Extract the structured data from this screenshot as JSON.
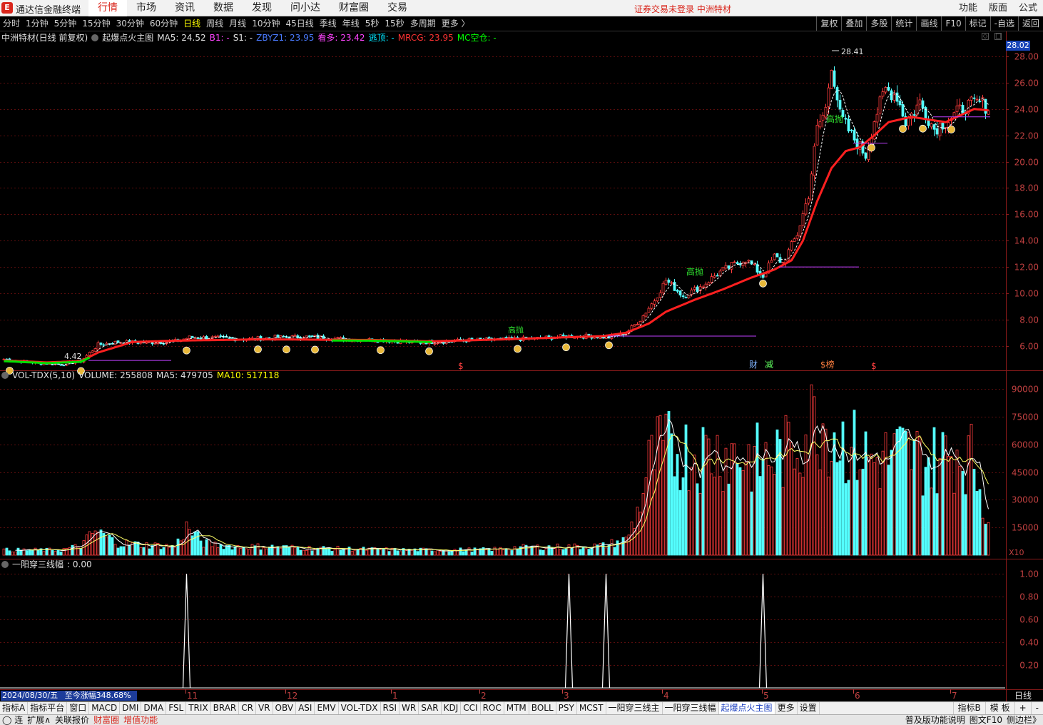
{
  "app": {
    "title": "通达信金融终端",
    "logo_char": "E"
  },
  "menu": {
    "items": [
      "行情",
      "市场",
      "资讯",
      "数据",
      "发现",
      "问小达",
      "财富圈",
      "交易"
    ],
    "active": "行情"
  },
  "login_status": "证券交易未登录  中洲特材",
  "right_menu": [
    "功能",
    "版面",
    "公式"
  ],
  "periods": {
    "items": [
      "分时",
      "1分钟",
      "5分钟",
      "15分钟",
      "30分钟",
      "60分钟",
      "日线",
      "周线",
      "月线",
      "10分钟",
      "45日线",
      "季线",
      "年线",
      "5秒",
      "15秒",
      "多周期",
      "更多 〉"
    ],
    "active": "日线"
  },
  "toolbar": [
    "复权",
    "叠加",
    "多股",
    "统计",
    "画线",
    "F10",
    "标记",
    "-自选",
    "返回"
  ],
  "main_header": {
    "stock": "中洲特材(日线 前复权)",
    "indicator": "起爆点火主图",
    "ma5": "MA5: 24.52",
    "b1": "B1: -",
    "s1": "S1: -",
    "zbyz": "ZBYZ1: 23.95",
    "kanduo": "看多: 23.42",
    "taoding": "逃顶: -",
    "mrcg": "MRCG: 23.95",
    "mc": "MC空仓: -"
  },
  "price_badge": "28.02",
  "vol_header": {
    "name": "VOL-TDX(5,10)",
    "volume": "VOLUME: 255808",
    "ma5": "MA5: 479705",
    "ma10": "MA10: 517118"
  },
  "ind_header": {
    "name": "一阳穿三线幅",
    "value": ": 0.00"
  },
  "annotations": {
    "high_price": "28.41",
    "low_price": "4.42",
    "gaopao": "高抛",
    "markers": [
      "财",
      "减",
      "$榜",
      "$",
      "$"
    ]
  },
  "chart_data": {
    "type": "candlestick",
    "price_axis": {
      "ticks": [
        6,
        8,
        10,
        12,
        14,
        16,
        18,
        20,
        22,
        24,
        26,
        28
      ],
      "range": [
        4.2,
        28.7
      ],
      "grid": true
    },
    "volume_axis": {
      "ticks": [
        15000,
        30000,
        45000,
        60000,
        75000,
        90000
      ],
      "range": [
        0,
        92000
      ],
      "unit": "X10"
    },
    "indicator_axis": {
      "ticks": [
        0.2,
        0.4,
        0.6,
        0.8,
        1.0
      ],
      "range": [
        0,
        1.05
      ]
    },
    "x_labels": [
      {
        "label": "11",
        "index": 64
      },
      {
        "label": "12",
        "index": 99
      },
      {
        "label": "1",
        "index": 136
      },
      {
        "label": "2",
        "index": 167
      },
      {
        "label": "3",
        "index": 196
      },
      {
        "label": "4",
        "index": 231
      },
      {
        "label": "5",
        "index": 266
      },
      {
        "label": "6",
        "index": 298
      },
      {
        "label": "7",
        "index": 332
      }
    ],
    "price_anchors": [
      [
        0,
        5.0
      ],
      [
        12,
        4.7
      ],
      [
        20,
        4.6
      ],
      [
        27,
        4.85
      ],
      [
        33,
        6.1
      ],
      [
        40,
        6.3
      ],
      [
        50,
        6.25
      ],
      [
        60,
        6.35
      ],
      [
        65,
        6.65
      ],
      [
        75,
        6.6
      ],
      [
        85,
        6.5
      ],
      [
        95,
        6.65
      ],
      [
        108,
        6.7
      ],
      [
        120,
        6.5
      ],
      [
        132,
        6.45
      ],
      [
        145,
        6.25
      ],
      [
        155,
        6.35
      ],
      [
        165,
        6.45
      ],
      [
        175,
        6.5
      ],
      [
        185,
        6.55
      ],
      [
        195,
        6.7
      ],
      [
        205,
        6.75
      ],
      [
        212,
        6.65
      ],
      [
        218,
        7.0
      ],
      [
        223,
        8.0
      ],
      [
        228,
        9.5
      ],
      [
        232,
        11.0
      ],
      [
        238,
        9.8
      ],
      [
        245,
        10.6
      ],
      [
        250,
        11.5
      ],
      [
        256,
        12.2
      ],
      [
        260,
        12.6
      ],
      [
        266,
        11.3
      ],
      [
        270,
        12.8
      ],
      [
        273,
        12.3
      ],
      [
        278,
        14.5
      ],
      [
        282,
        17.5
      ],
      [
        285,
        22.5
      ],
      [
        288,
        24.0
      ],
      [
        290,
        27.5
      ],
      [
        293,
        23.5
      ],
      [
        297,
        22.0
      ],
      [
        302,
        20.5
      ],
      [
        305,
        23.2
      ],
      [
        309,
        25.5
      ],
      [
        313,
        25.0
      ],
      [
        316,
        23.0
      ],
      [
        321,
        24.5
      ],
      [
        326,
        22.5
      ],
      [
        331,
        23.2
      ],
      [
        337,
        24.2
      ],
      [
        342,
        24.5
      ],
      [
        345,
        24.1
      ]
    ],
    "mrcg_anchors": [
      [
        0,
        4.9
      ],
      [
        15,
        4.75
      ],
      [
        27,
        4.85
      ],
      [
        33,
        5.5
      ],
      [
        45,
        6.3
      ],
      [
        60,
        6.4
      ],
      [
        90,
        6.5
      ],
      [
        130,
        6.45
      ],
      [
        150,
        6.35
      ],
      [
        175,
        6.5
      ],
      [
        210,
        6.75
      ],
      [
        218,
        7.0
      ],
      [
        226,
        7.7
      ],
      [
        232,
        8.6
      ],
      [
        242,
        9.5
      ],
      [
        252,
        10.3
      ],
      [
        262,
        11.2
      ],
      [
        270,
        11.8
      ],
      [
        276,
        12.5
      ],
      [
        280,
        14.0
      ],
      [
        285,
        17.0
      ],
      [
        290,
        19.5
      ],
      [
        295,
        20.8
      ],
      [
        300,
        21.1
      ],
      [
        305,
        22.0
      ],
      [
        310,
        23.0
      ],
      [
        318,
        23.4
      ],
      [
        330,
        23.0
      ],
      [
        340,
        24.0
      ],
      [
        345,
        23.9
      ]
    ],
    "volume_anchors": [
      [
        0,
        3000
      ],
      [
        20,
        3000
      ],
      [
        27,
        5500
      ],
      [
        32,
        14000
      ],
      [
        40,
        7000
      ],
      [
        60,
        5000
      ],
      [
        64,
        16000
      ],
      [
        70,
        7000
      ],
      [
        80,
        5000
      ],
      [
        90,
        5000
      ],
      [
        110,
        4000
      ],
      [
        140,
        3000
      ],
      [
        170,
        3200
      ],
      [
        180,
        4500
      ],
      [
        200,
        5000
      ],
      [
        210,
        5500
      ],
      [
        218,
        9000
      ],
      [
        222,
        25000
      ],
      [
        226,
        52000
      ],
      [
        230,
        62000
      ],
      [
        240,
        60000
      ],
      [
        255,
        60000
      ],
      [
        265,
        55000
      ],
      [
        275,
        60000
      ],
      [
        285,
        82000
      ],
      [
        295,
        65000
      ],
      [
        305,
        55000
      ],
      [
        315,
        60000
      ],
      [
        325,
        55000
      ],
      [
        335,
        62000
      ],
      [
        340,
        55000
      ],
      [
        344,
        25000
      ]
    ],
    "indicator_spikes": [
      64,
      198,
      211,
      266
    ],
    "bar_count": 346,
    "series": [
      {
        "name": "MRCG",
        "color": "#ff2020"
      },
      {
        "name": "MA5",
        "color": "#ffffff"
      },
      {
        "name": "VOL MA5",
        "color": "#ffffff"
      },
      {
        "name": "VOL MA10",
        "color": "#ffff66"
      }
    ]
  },
  "date_info": {
    "date": "2024/08/30/五",
    "change": "至今涨幅348.68%"
  },
  "period_label": "日线",
  "tabs": {
    "items": [
      "指标A",
      "指标平台",
      "窗口",
      "MACD",
      "DMI",
      "DMA",
      "FSL",
      "TRIX",
      "BRAR",
      "CR",
      "VR",
      "OBV",
      "ASI",
      "EMV",
      "VOL-TDX",
      "RSI",
      "WR",
      "SAR",
      "KDJ",
      "CCI",
      "ROC",
      "MTM",
      "BOLL",
      "PSY",
      "MCST",
      "一阳穿三线主",
      "一阳穿三线幅",
      "起爆点火主图",
      "更多",
      "设置"
    ],
    "active": "起爆点火主图"
  },
  "tabs_right": [
    "指标B",
    "模 板",
    "+",
    "-"
  ],
  "status": {
    "left": [
      "◯ 连",
      "扩展∧",
      "关联报价",
      "财富圈",
      "增值功能"
    ],
    "right": [
      "普及版功能说明",
      "图文F10",
      "侧边栏》"
    ]
  }
}
